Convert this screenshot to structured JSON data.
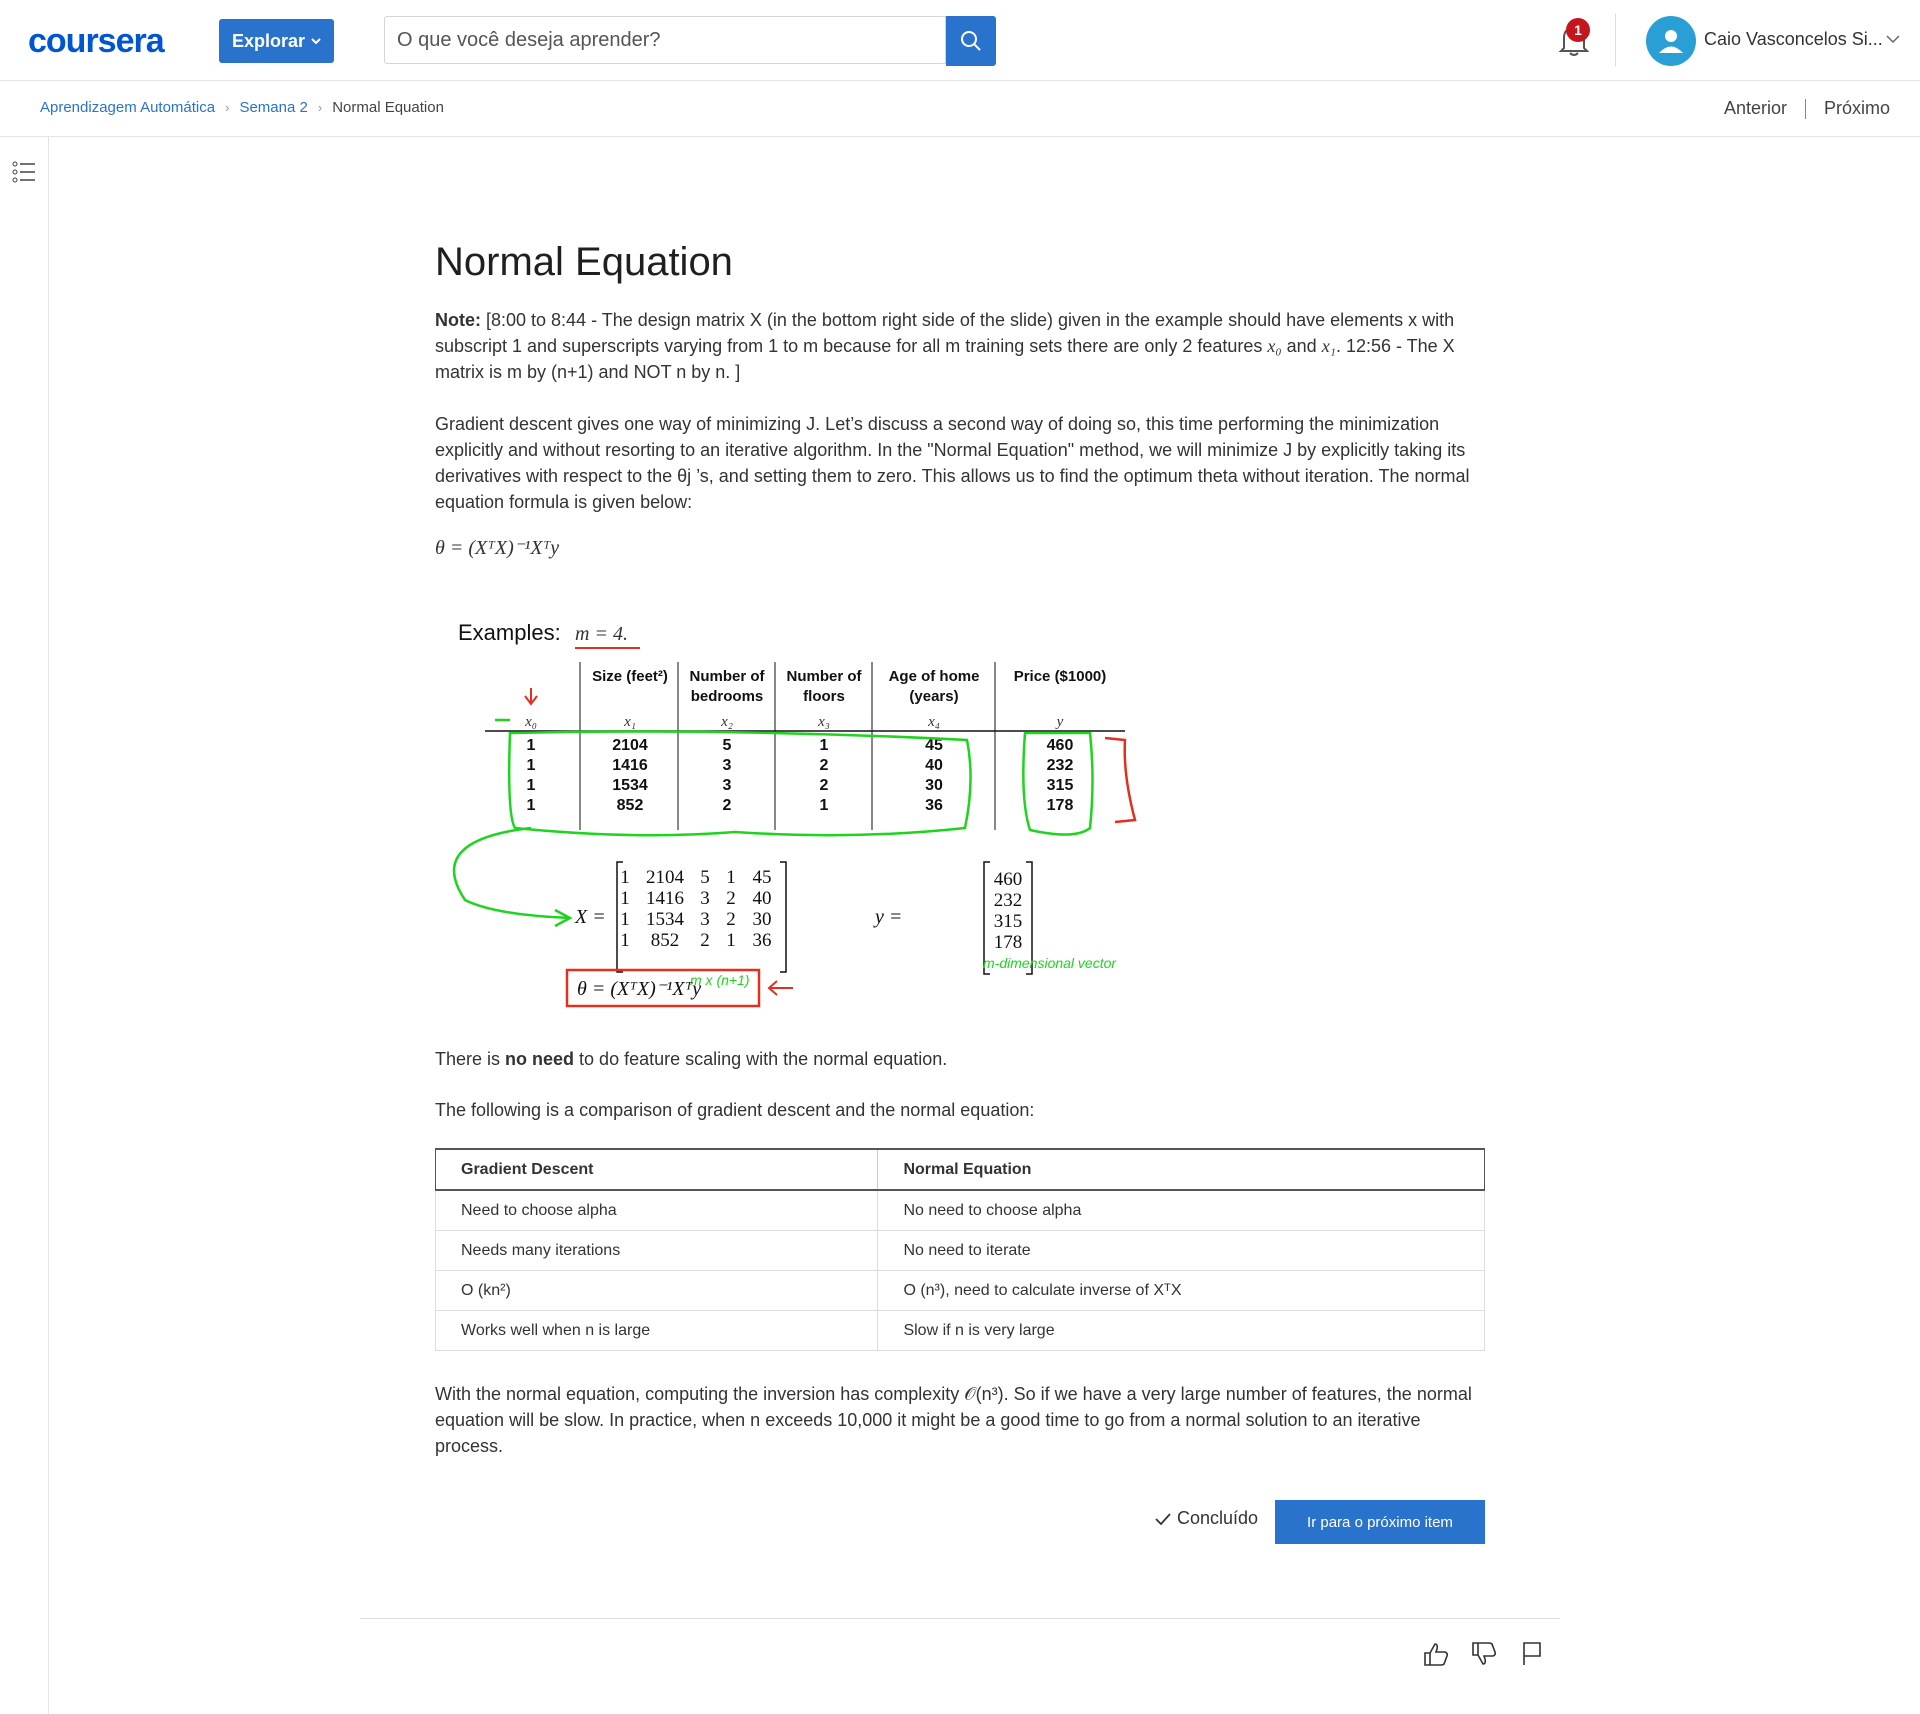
{
  "header": {
    "logo": "coursera",
    "explore_label": "Explorar",
    "search_placeholder": "O que você deseja aprender?",
    "notification_count": "1",
    "user_name": "Caio Vasconcelos Si..."
  },
  "breadcrumb": {
    "items": [
      "Aprendizagem Automática",
      "Semana 2",
      "Normal Equation"
    ],
    "prev_label": "Anterior",
    "next_label": "Próximo"
  },
  "article": {
    "title": "Normal Equation",
    "note_label": "Note:",
    "note_text_1": " [8:00 to 8:44 - The design matrix X (in the bottom right side of the slide) given in the example should have elements x with subscript 1 and superscripts varying from 1 to m because for all m training sets there are only 2 features ",
    "note_x0": "x₀",
    "note_and": " and ",
    "note_x1": "x₁",
    "note_text_2": ". 12:56 - The X matrix is m by (n+1) and NOT n by n. ]",
    "para_intro": "Gradient descent gives one way of minimizing J. Let’s discuss a second way of doing so, this time performing the minimization explicitly and without resorting to an iterative algorithm. In the \"Normal Equation\" method, we will minimize J by explicitly taking its derivatives with respect to the θj ’s, and setting them to zero. This allows us to find the optimum theta without iteration. The normal equation formula is given below:",
    "formula": "θ = (XᵀX)⁻¹Xᵀy",
    "scaling_1": "There is ",
    "scaling_bold": "no need",
    "scaling_2": " to do feature scaling with the normal equation.",
    "comparison_intro": "The following is a comparison of gradient descent and the normal equation:",
    "closing": "With the normal equation, computing the inversion has complexity 𝒪(n³). So if we have a very large number of features, the normal equation will be slow. In practice, when n exceeds 10,000 it might be a good time to go from a normal solution to an iterative process."
  },
  "slide": {
    "examples_label": "Examples:",
    "m_label": "m = 4.",
    "headers": [
      "",
      "Size (feet²)",
      "Number of",
      "Number of",
      "Age of home",
      "Price ($1000)"
    ],
    "headers2": [
      "",
      "",
      "bedrooms",
      "floors",
      "(years)",
      ""
    ],
    "vars": [
      "x₀",
      "x₁",
      "x₂",
      "x₃",
      "x₄",
      "y"
    ],
    "rows": [
      [
        "1",
        "2104",
        "5",
        "1",
        "45",
        "460"
      ],
      [
        "1",
        "1416",
        "3",
        "2",
        "40",
        "232"
      ],
      [
        "1",
        "1534",
        "3",
        "2",
        "30",
        "315"
      ],
      [
        "1",
        "852",
        "2",
        "1",
        "36",
        "178"
      ]
    ],
    "x_label": "X =",
    "y_label": "y =",
    "matrix_X": [
      [
        "1",
        "2104",
        "5",
        "1",
        "45"
      ],
      [
        "1",
        "1416",
        "3",
        "2",
        "40"
      ],
      [
        "1",
        "1534",
        "3",
        "2",
        "30"
      ],
      [
        "1",
        "852",
        "2",
        "1",
        "36"
      ]
    ],
    "vector_y": [
      "460",
      "232",
      "315",
      "178"
    ],
    "m_by_n": "m x (n+1)",
    "m_dim": "m-dimensional vector",
    "boxed_formula": "θ = (XᵀX)⁻¹Xᵀy"
  },
  "comparison_table": {
    "headers": [
      "Gradient Descent",
      "Normal Equation"
    ],
    "rows": [
      [
        "Need to choose alpha",
        "No need to choose alpha"
      ],
      [
        "Needs many iterations",
        "No need to iterate"
      ],
      [
        "O (kn²)",
        "O (n³), need to calculate inverse of XᵀX"
      ],
      [
        "Works well when n is large",
        "Slow if n is very large"
      ]
    ]
  },
  "footer": {
    "done_label": "Concluído",
    "next_item_label": "Ir para o próximo item"
  },
  "colors": {
    "accent": "#2a73cc",
    "brand": "#0056d2",
    "badge": "#c4161c",
    "annotation_green": "#1ed41e",
    "annotation_red": "#e03020"
  }
}
